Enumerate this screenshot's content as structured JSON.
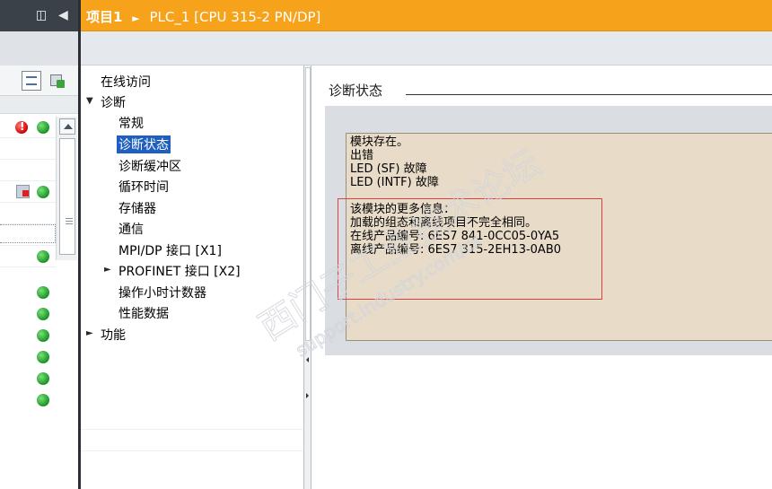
{
  "header": {
    "breadcrumb": [
      "项目1",
      "PLC_1 [CPU 315-2 PN/DP]"
    ],
    "separator": "►"
  },
  "nav": {
    "items": [
      {
        "label": "在线访问",
        "level": 0,
        "expander": ""
      },
      {
        "label": "诊断",
        "level": 0,
        "expander": "▼"
      },
      {
        "label": "常规",
        "level": 1,
        "expander": ""
      },
      {
        "label": "诊断状态",
        "level": 1,
        "expander": "",
        "selected": true
      },
      {
        "label": "诊断缓冲区",
        "level": 1,
        "expander": ""
      },
      {
        "label": "循环时间",
        "level": 1,
        "expander": ""
      },
      {
        "label": "存储器",
        "level": 1,
        "expander": ""
      },
      {
        "label": "通信",
        "level": 1,
        "expander": ""
      },
      {
        "label": "MPI/DP 接口 [X1]",
        "level": 1,
        "expander": ""
      },
      {
        "label": "PROFINET 接口 [X2]",
        "level": 1,
        "expander": "►"
      },
      {
        "label": "操作小时计数器",
        "level": 1,
        "expander": ""
      },
      {
        "label": "性能数据",
        "level": 1,
        "expander": ""
      },
      {
        "label": "功能",
        "level": 0,
        "expander": "►"
      }
    ]
  },
  "content": {
    "section_title": "诊断状态",
    "status_lines": [
      "模块存在。",
      "出错",
      "LED (SF) 故障",
      "LED (INTF) 故障",
      "",
      "该模块的更多信息：",
      "加载的组态和离线项目不完全相同。",
      "在线产品编号:  6ES7 841-0CC05-0YA5",
      "离线产品编号:  6ES7 315-2EH13-0AB0"
    ]
  },
  "left_panel": {
    "status_icons": [
      "error-ok",
      "",
      "",
      "",
      "fault-ok",
      "",
      "",
      "",
      "ok",
      "",
      "",
      "ok",
      "ok",
      "ok",
      "ok",
      "ok",
      "ok"
    ]
  },
  "watermark": {
    "line1": "西门子工业技术论坛",
    "line2": "support.industry.com/cs"
  },
  "colors": {
    "accent_orange": "#f7a21b",
    "selection_blue": "#1f5fbf",
    "status_box": "#e8dcc9",
    "highlight_red": "#e04040"
  }
}
